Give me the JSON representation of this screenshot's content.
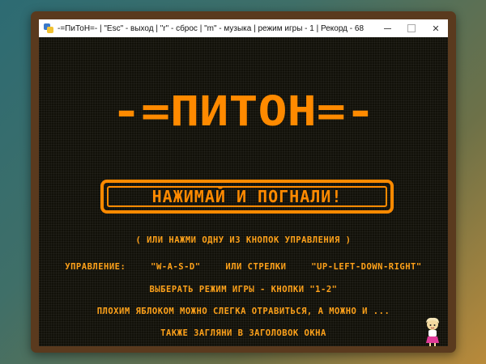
{
  "window": {
    "title": "-=ПиТоН=-  | \"Esc\" - выход | \"r\" - сброс | \"m\" - музыка | режим игры - 1 | Рекорд - 68",
    "controls": {
      "minimize": "—",
      "maximize": "",
      "close": "✕"
    }
  },
  "game": {
    "logo": "-=ПИТОН=-",
    "start_button": "НАЖИМАЙ И ПОГНАЛИ!",
    "hint": "( ИЛИ НАЖМИ ОДНУ ИЗ КНОПОК УПРАВЛЕНИЯ )",
    "controls_label": "УПРАВЛЕНИЕ:",
    "controls_wasd": "\"W-A-S-D\"",
    "controls_or": "ИЛИ СТРЕЛКИ",
    "controls_arrows": "\"UP-LEFT-DOWN-RIGHT\"",
    "mode_line": "ВЫБЕРАТЬ РЕЖИМ ИГРЫ - КНОПКИ \"1-2\"",
    "apple_line": "ПЛОХИМ ЯБЛОКОМ МОЖНО СЛЕГКА ОТРАВИТЬСЯ, А МОЖНО И ...",
    "title_line": "ТАКЖЕ ЗАГЛЯНИ В ЗАГОЛОВОК ОКНА"
  },
  "colors": {
    "accent": "#ff8a00",
    "text": "#ffa21a",
    "background": "#121109",
    "frame": "#5a3a1e"
  },
  "icons": {
    "app": "python-icon",
    "mascot": "girl-character-icon"
  }
}
